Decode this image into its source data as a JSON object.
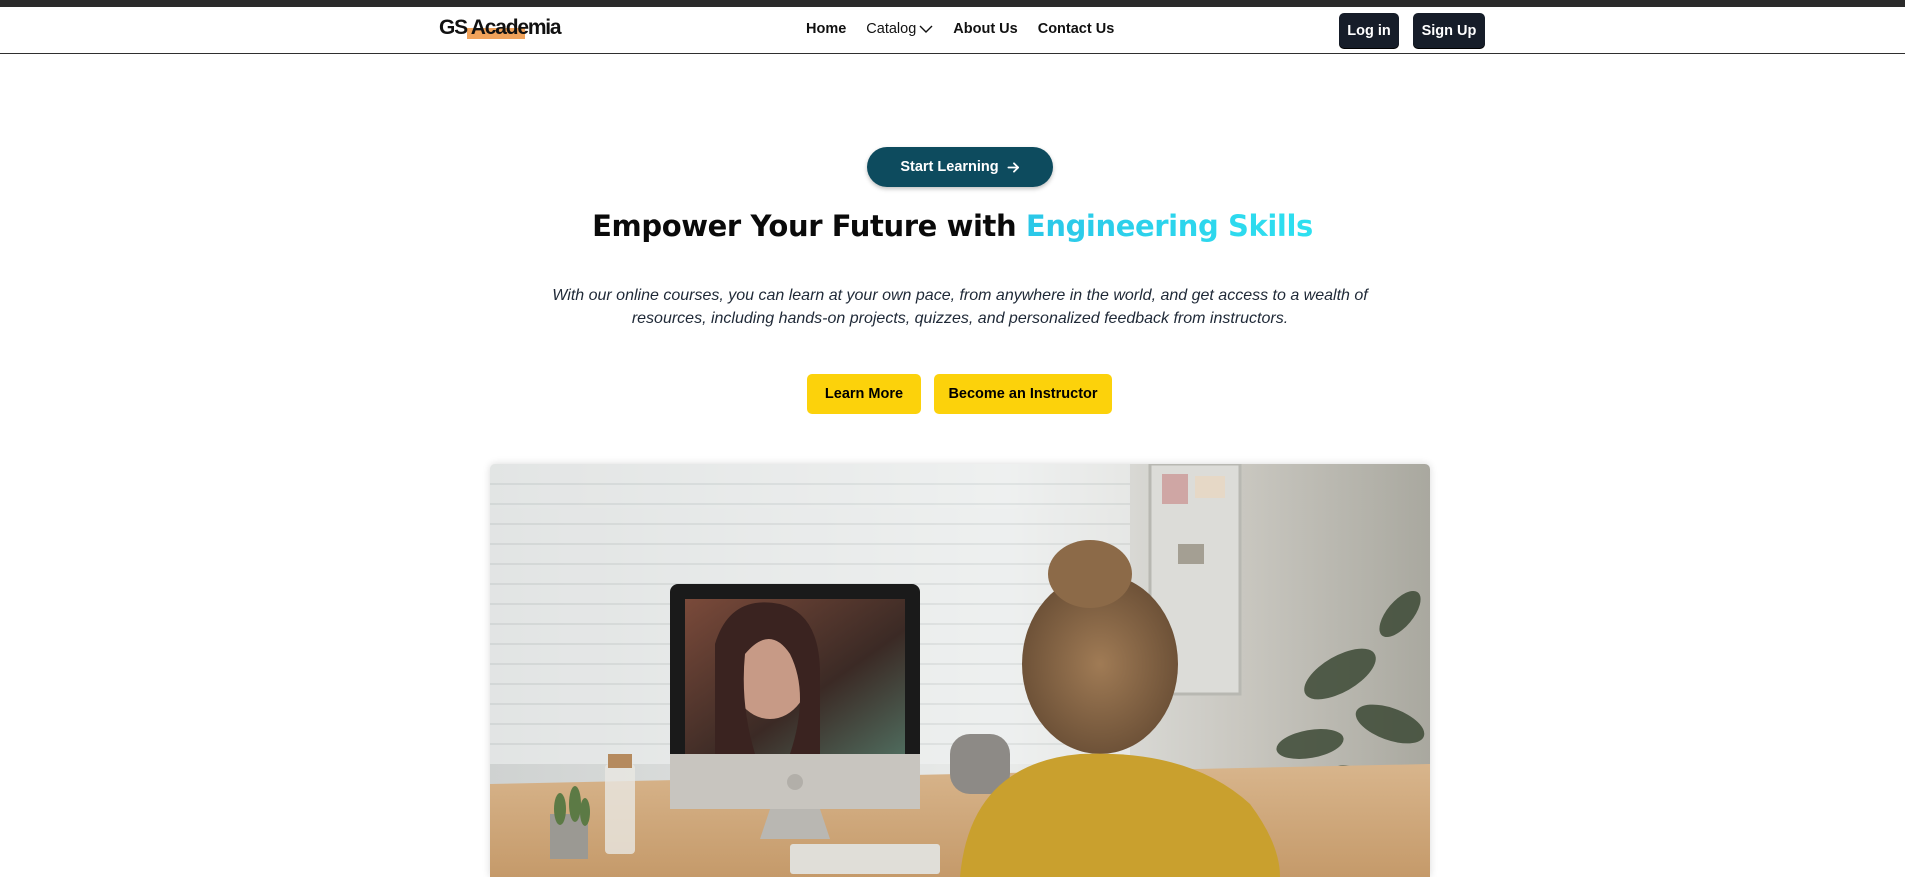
{
  "nav": {
    "logo": "GS Academia",
    "links": [
      "Home",
      "Catalog",
      "About Us",
      "Contact Us"
    ],
    "login": "Log in",
    "signup": "Sign Up"
  },
  "hero": {
    "badge_button": "Start Learning",
    "headline_prefix": "Empower Your Future with ",
    "headline_highlight": "Engineering Skills",
    "description": "With our online courses, you can learn at your own pace, from anywhere in the world, and get access to a wealth of resources, including hands-on projects, quizzes, and personalized feedback from instructors.",
    "cta_primary": "Learn More",
    "cta_secondary": "Become an Instructor"
  },
  "colors": {
    "brand_dark": "#161d29",
    "accent_teal": "#0d4b5e",
    "highlight_cyan": "#2bc7e8",
    "cta_yellow": "#fcd20b"
  },
  "icons": {
    "catalog_dropdown": "chevron-down-icon",
    "start_arrow": "arrow-right-icon"
  }
}
